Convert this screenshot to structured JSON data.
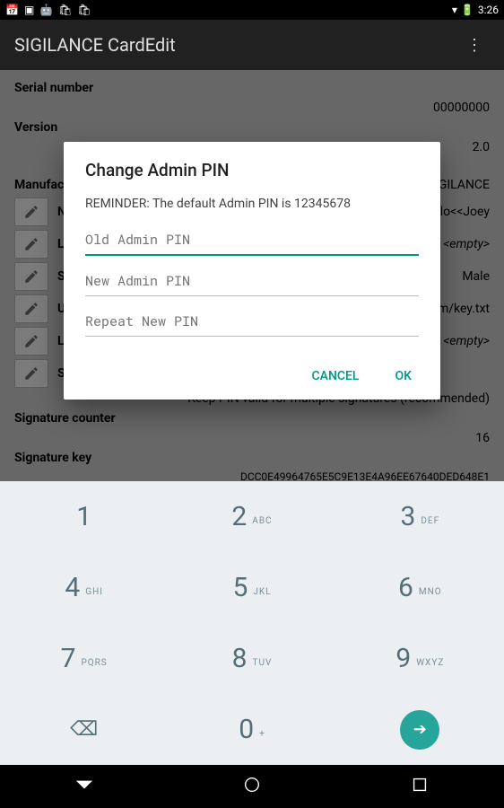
{
  "status": {
    "time": "3:26"
  },
  "appbar": {
    "title": "SIGILANCE CardEdit"
  },
  "list": {
    "serial_label": "Serial number",
    "serial_value": "00000000",
    "version_label": "Version",
    "version_value": "2.0",
    "manuf_label": "Manufact",
    "manuf_value": "IGILANCE",
    "name_value": "llo<<Joey",
    "lang_value": "<empty>",
    "sex_value": "Male",
    "url_value": "m/key.txt",
    "login_value": "<empty>",
    "sigpin_label": "Signature PIN Behavior",
    "sigpin_value": "Keep PIN valid for multiple signatures (recommended)",
    "sigcnt_label": "Signature counter",
    "sigcnt_value": "16",
    "sigkey_label": "Signature key",
    "sigkey_value": "DCC0E49964765E5C9E13E4A96EE67640DED648E1"
  },
  "dialog": {
    "title": "Change Admin PIN",
    "msg": "REMINDER: The default Admin PIN is 12345678",
    "ph_old": "Old Admin PIN",
    "ph_new": "New Admin PIN",
    "ph_repeat": "Repeat New PIN",
    "cancel": "CANCEL",
    "ok": "OK"
  },
  "keys": {
    "k1": "1",
    "k2": "2",
    "k2l": "ABC",
    "k3": "3",
    "k3l": "DEF",
    "k4": "4",
    "k4l": "GHI",
    "k5": "5",
    "k5l": "JKL",
    "k6": "6",
    "k6l": "MNO",
    "k7": "7",
    "k7l": "PQRS",
    "k8": "8",
    "k8l": "TUV",
    "k9": "9",
    "k9l": "WXYZ",
    "k0": "0",
    "k0l": "+"
  }
}
